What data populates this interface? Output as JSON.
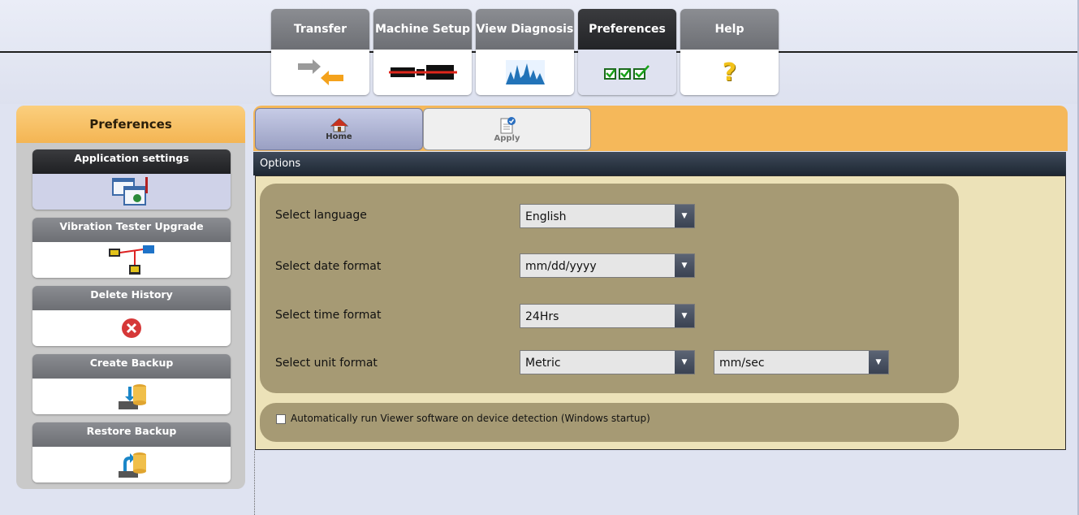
{
  "nav_tabs": [
    {
      "label": "Transfer",
      "icon": "transfer-icon"
    },
    {
      "label": "Machine Setup",
      "icon": "machine-setup-icon"
    },
    {
      "label": "View Diagnosis",
      "icon": "diagnosis-chart-icon"
    },
    {
      "label": "Preferences",
      "icon": "checkboxes-icon",
      "active": true
    },
    {
      "label": "Help",
      "icon": "question-icon"
    }
  ],
  "sidebar": {
    "title": "Preferences",
    "items": [
      {
        "label": "Application settings",
        "icon": "application-settings-icon",
        "active": true
      },
      {
        "label": "Vibration Tester Upgrade",
        "icon": "device-upgrade-icon"
      },
      {
        "label": "Delete History",
        "icon": "delete-icon"
      },
      {
        "label": "Create Backup",
        "icon": "create-backup-icon"
      },
      {
        "label": "Restore Backup",
        "icon": "restore-backup-icon"
      }
    ]
  },
  "toolbar": {
    "home_label": "Home",
    "apply_label": "Apply"
  },
  "options": {
    "header": "Options",
    "language": {
      "label": "Select language",
      "value": "English"
    },
    "date_format": {
      "label": "Select date format",
      "value": "mm/dd/yyyy"
    },
    "time_format": {
      "label": "Select time format",
      "value": "24Hrs"
    },
    "unit_format": {
      "label": "Select unit format",
      "value": "Metric",
      "secondary_value": "mm/sec"
    },
    "autorun": {
      "label": "Automatically run Viewer software on device detection (Windows startup)",
      "checked": false
    }
  },
  "colors": {
    "accent_orange": "#f5b85a",
    "panel_tan": "#a69a74",
    "option_bg": "#ece2b8"
  }
}
